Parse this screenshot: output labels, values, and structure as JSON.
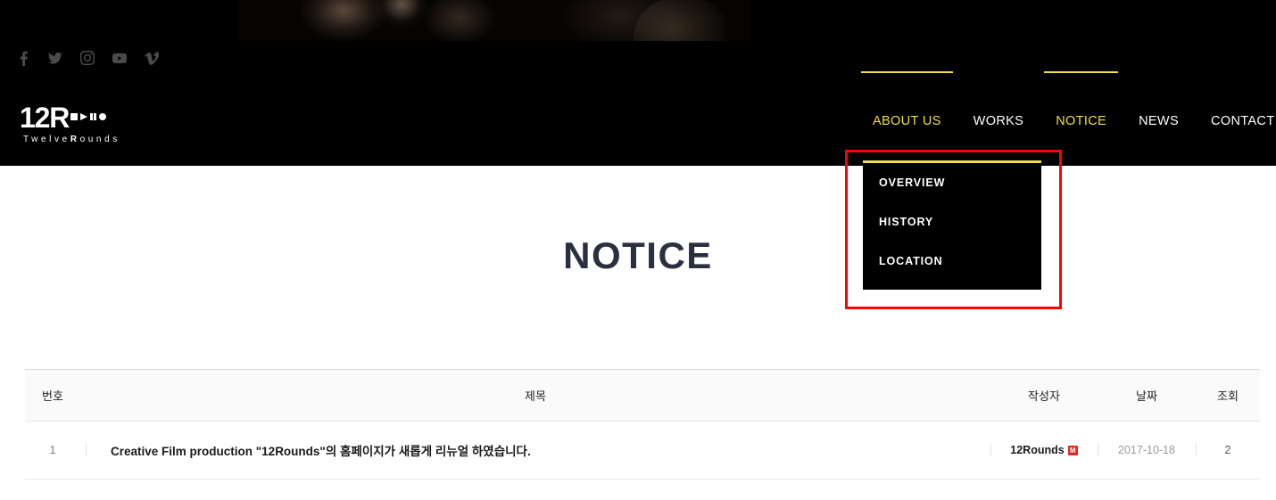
{
  "header": {
    "social": [
      {
        "name": "facebook-icon",
        "label": "Facebook"
      },
      {
        "name": "twitter-icon",
        "label": "Twitter"
      },
      {
        "name": "instagram-icon",
        "label": "Instagram"
      },
      {
        "name": "youtube-icon",
        "label": "YouTube"
      },
      {
        "name": "vimeo-icon",
        "label": "Vimeo"
      }
    ],
    "logo": {
      "main": "12R",
      "sub_prefix": "T",
      "sub_mid": "welve",
      "sub_bold": "R",
      "sub_suffix": "ounds",
      "sub_full": "TwelveRounds"
    },
    "nav": [
      {
        "label": "ABOUT US",
        "active": true
      },
      {
        "label": "WORKS",
        "active": false
      },
      {
        "label": "NOTICE",
        "active": true
      },
      {
        "label": "NEWS",
        "active": false
      },
      {
        "label": "CONTACT US",
        "active": false
      }
    ]
  },
  "dropdown": {
    "items": [
      {
        "label": "OVERVIEW"
      },
      {
        "label": "HISTORY"
      },
      {
        "label": "LOCATION"
      }
    ]
  },
  "main": {
    "title": "NOTICE",
    "table": {
      "headers": {
        "no": "번호",
        "title": "제목",
        "author": "작성자",
        "date": "날짜",
        "hits": "조회"
      },
      "rows": [
        {
          "no": "1",
          "title": "Creative Film production \"12Rounds\"의 홈페이지가 새롭게 리뉴얼 하였습니다.",
          "author": "12Rounds",
          "author_badge": "M",
          "date": "2017-10-18",
          "hits": "2"
        }
      ]
    }
  },
  "colors": {
    "accent_yellow": "#f2dd4b",
    "highlight_red": "#ff0000",
    "header_black": "#000000",
    "title_navy": "#2b3040",
    "badge_red": "#e8271e"
  }
}
